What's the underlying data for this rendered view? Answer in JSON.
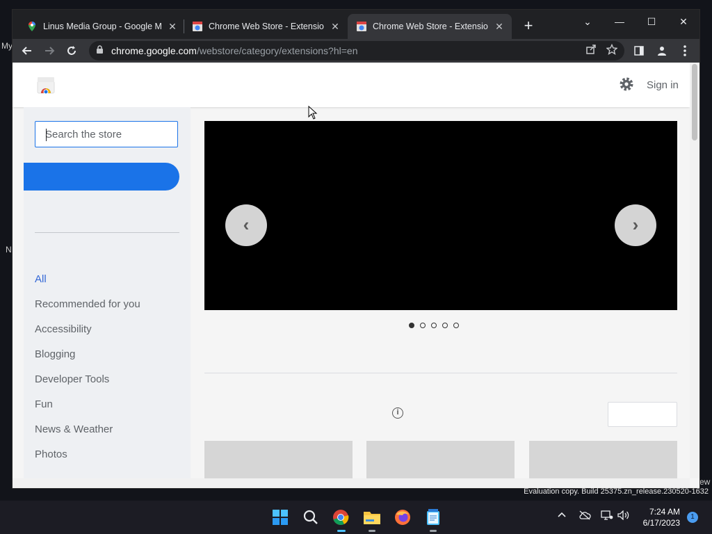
{
  "desktop": {
    "fragments": [
      "My",
      "N"
    ],
    "taskbar_edge_text": "ew"
  },
  "tabs": [
    {
      "title": "Linus Media Group - Google Ma",
      "close": "✕"
    },
    {
      "title": "Chrome Web Store - Extensions",
      "close": "✕"
    },
    {
      "title": "Chrome Web Store - Extensions",
      "close": "✕"
    }
  ],
  "new_tab": "+",
  "window_controls": {
    "dropdown": "⌄",
    "minimize": "—",
    "maximize": "☐",
    "close": "✕"
  },
  "address": {
    "host": "chrome.google.com",
    "path": "/webstore/category/extensions?hl=en"
  },
  "header": {
    "sign_in": "Sign in"
  },
  "search": {
    "placeholder": "Search the store"
  },
  "categories": [
    "All",
    "Recommended for you",
    "Accessibility",
    "Blogging",
    "Developer Tools",
    "Fun",
    "News & Weather",
    "Photos"
  ],
  "carousel": {
    "prev": "‹",
    "next": "›",
    "dots": 5,
    "active_dot": 0
  },
  "status": {
    "eval": "Evaluation copy. Build 25375.zn_release.230520-1632"
  },
  "clock": {
    "time": "7:24 AM",
    "date": "6/17/2023"
  },
  "notifications": "1",
  "colors": {
    "accent": "#1a73e8",
    "selected_category": "#3367d6",
    "tab_bar": "#202124",
    "toolbar": "#35363a"
  }
}
